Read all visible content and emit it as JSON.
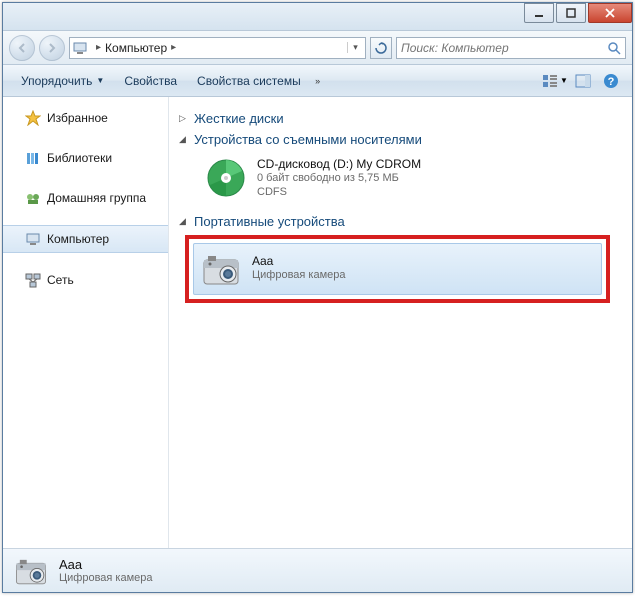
{
  "titlebar": {},
  "nav": {
    "breadcrumb_icon": "computer-icon",
    "breadcrumb_text": "Компьютер",
    "search_placeholder": "Поиск: Компьютер"
  },
  "cmdbar": {
    "organize": "Упорядочить",
    "properties": "Свойства",
    "system_properties": "Свойства системы"
  },
  "sidebar": {
    "items": [
      {
        "label": "Избранное",
        "icon": "star"
      },
      {
        "label": "Библиотеки",
        "icon": "lib"
      },
      {
        "label": "Домашняя группа",
        "icon": "home"
      },
      {
        "label": "Компьютер",
        "icon": "pc",
        "selected": true
      },
      {
        "label": "Сеть",
        "icon": "net"
      }
    ]
  },
  "content": {
    "section_hdd": "Жесткие диски",
    "section_removable": "Устройства со съемными носителями",
    "section_portable": "Портативные устройства",
    "cd": {
      "title": "CD-дисковод (D:) My CDROM",
      "sub1": "0 байт свободно из 5,75 МБ",
      "sub2": "CDFS"
    },
    "camera": {
      "title": "Aaa",
      "sub": "Цифровая камера"
    }
  },
  "status": {
    "title": "Aaa",
    "sub": "Цифровая камера"
  }
}
